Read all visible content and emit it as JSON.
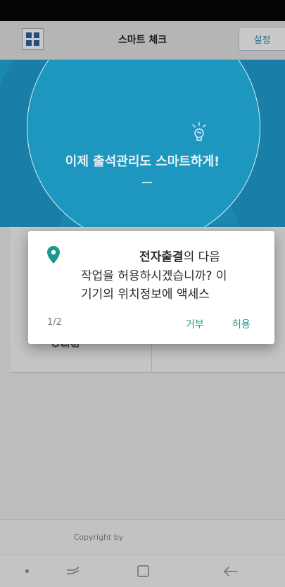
{
  "header": {
    "title": "스마트 체크",
    "settings_label": "설정",
    "menu_icon": "grid-icon"
  },
  "hero": {
    "headline": "이제 출석관리도 스마트하게!",
    "icon": "lightbulb-icon"
  },
  "content": {
    "partial_label": "오림일"
  },
  "dialog": {
    "icon": "location-pin-icon",
    "app_name": "전자출결",
    "line1_suffix": "의 다음",
    "line2": "작업을 허용하시겠습니까? 이",
    "line3": "기기의 위치정보에 액세스",
    "page_count": "1/2",
    "deny_label": "거부",
    "allow_label": "허용",
    "accent_color": "#1a9a8e"
  },
  "footer": {
    "copyright": "Copyright by"
  },
  "nav": {
    "icons": [
      "dot-icon",
      "recent-apps-icon",
      "home-icon",
      "back-icon"
    ]
  }
}
